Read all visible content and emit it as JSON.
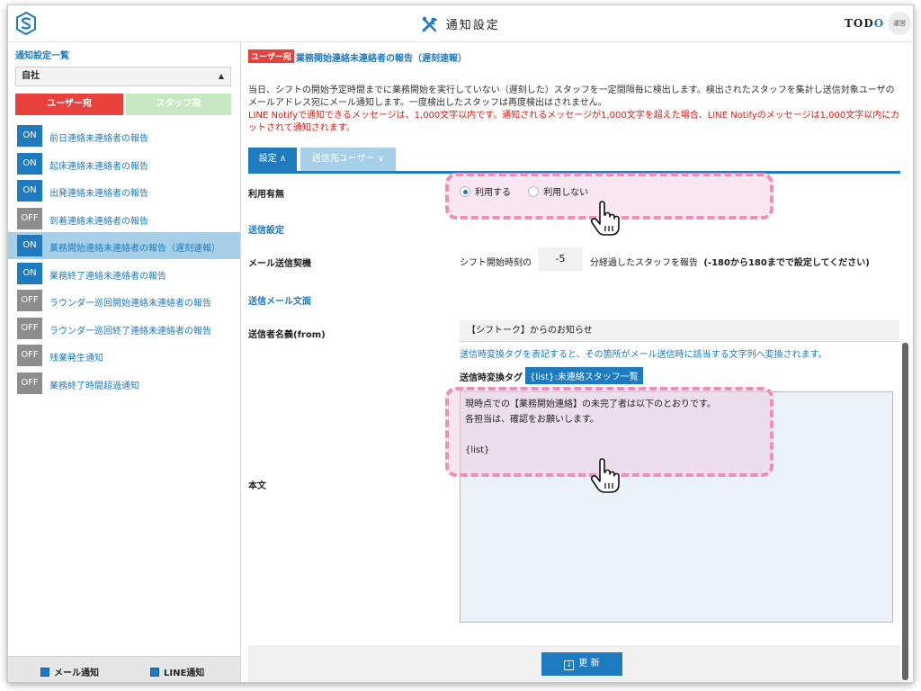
{
  "header": {
    "title": "通知設定",
    "todo": {
      "part1": "TOD",
      "part2": "O"
    },
    "avatar_text": "運営"
  },
  "sidebar": {
    "title": "通知設定一覧",
    "select_value": "自社",
    "tab_user": "ユーザー宛",
    "tab_staff": "スタッフ宛",
    "items": [
      {
        "status": "ON",
        "label": "前日連絡未連絡者の報告"
      },
      {
        "status": "ON",
        "label": "起床連絡未連絡者の報告"
      },
      {
        "status": "ON",
        "label": "出発連絡未連絡者の報告"
      },
      {
        "status": "OFF",
        "label": "到着連絡未連絡者の報告"
      },
      {
        "status": "ON",
        "label": "業務開始連絡未連絡者の報告（遅刻速報）",
        "active": true
      },
      {
        "status": "ON",
        "label": "業務終了連絡未連絡者の報告"
      },
      {
        "status": "OFF",
        "label": "ラウンダー巡回開始連絡未連絡者の報告"
      },
      {
        "status": "OFF",
        "label": "ラウンダー巡回終了連絡未連絡者の報告"
      },
      {
        "status": "OFF",
        "label": "残業発生通知"
      },
      {
        "status": "OFF",
        "label": "業務終了時間超過通知"
      }
    ],
    "footer": {
      "mail": "メール通知",
      "line": "LINE通知"
    }
  },
  "main": {
    "tag": "ユーザー宛",
    "heading": "業務開始連絡未連絡者の報告（遅刻速報）",
    "description": "当日、シフトの開始予定時間までに業務開始を実行していない（遅刻した）スタッフを一定間隔毎に検出します。検出されたスタッフを集計し送信対象ユーザのメールアドレス宛にメール通知します。一度検出したスタッフは再度検出はされません。",
    "warning": "LINE Notifyで通知できるメッセージは、1,000文字以内です。通知されるメッセージが1,000文字を超えた場合、LINE Notifyのメッセージは1,000文字以内にカットされて通知されます。",
    "tabs": {
      "settings": "設定 ∧",
      "recipients": "送信先ユーザー ∨"
    },
    "usage_label": "利用有無",
    "radio_use": "利用する",
    "radio_nouse": "利用しない",
    "send_settings_label": "送信設定",
    "mail_trigger_label": "メール送信契機",
    "trigger_prefix": "シフト開始時刻の",
    "trigger_value": "-5",
    "trigger_suffix": "分経過したスタッフを報告",
    "trigger_note": "(-180から180までで設定してください)",
    "mail_body_section": "送信メール文面",
    "from_label": "送信者名義(from)",
    "from_value": "【シフトーク】からのお知らせ",
    "tag_hint": "送信時変換タグを表記すると、その箇所がメール送信時に該当する文字列へ変換されます。",
    "tag_row_label": "送信時変換タグ",
    "tag_chip": "{list}:未連絡スタッフ一覧",
    "body_label": "本文",
    "body_text": "現時点での【業務開始連絡】の未完了者は以下のとおりです。\n各担当は、確認をお願いします。\n\n{list}",
    "update_button": "更 新"
  }
}
